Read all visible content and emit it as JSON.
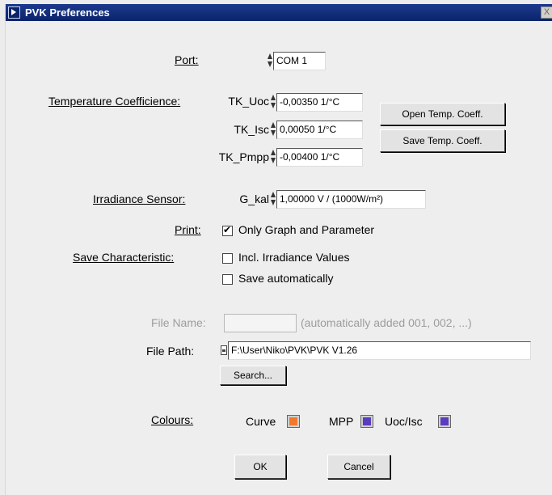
{
  "window": {
    "title": "PVK Preferences",
    "close": "X"
  },
  "port": {
    "label": "Port:",
    "value": "COM 1"
  },
  "temperature": {
    "label": "Temperature Coefficience:",
    "uoc_label": "TK_Uoc",
    "uoc_value": "-0,00350  1/°C",
    "isc_label": "TK_Isc",
    "isc_value": "0,00050  1/°C",
    "pmpp_label": "TK_Pmpp",
    "pmpp_value": "-0,00400  1/°C",
    "open_button": "Open Temp. Coeff.",
    "save_button": "Save Temp. Coeff."
  },
  "irradiance": {
    "label": "Irradiance Sensor:",
    "gkal_label": "G_kal",
    "gkal_value": "1,00000   V / (1000W/m²)"
  },
  "print": {
    "label": "Print:",
    "option": "Only Graph and Parameter",
    "checked": true
  },
  "save_characteristic": {
    "label": "Save Characteristic:",
    "incl_irradiance": "Incl. Irradiance Values",
    "save_auto": "Save automatically"
  },
  "file": {
    "name_label": "File Name:",
    "name_value": "",
    "name_hint": "(automatically added 001, 002, ...)",
    "path_label": "File Path:",
    "path_value": "F:\\User\\Niko\\PVK\\PVK V1.26",
    "search_button": "Search..."
  },
  "colours": {
    "label": "Colours:",
    "curve": "Curve",
    "mpp": "MPP",
    "uoc_isc": "Uoc/Isc",
    "curve_color": "#f07a2c",
    "mpp_color": "#5a3cc0",
    "uoc_isc_color": "#5a3cc0"
  },
  "buttons": {
    "ok": "OK",
    "cancel": "Cancel"
  }
}
